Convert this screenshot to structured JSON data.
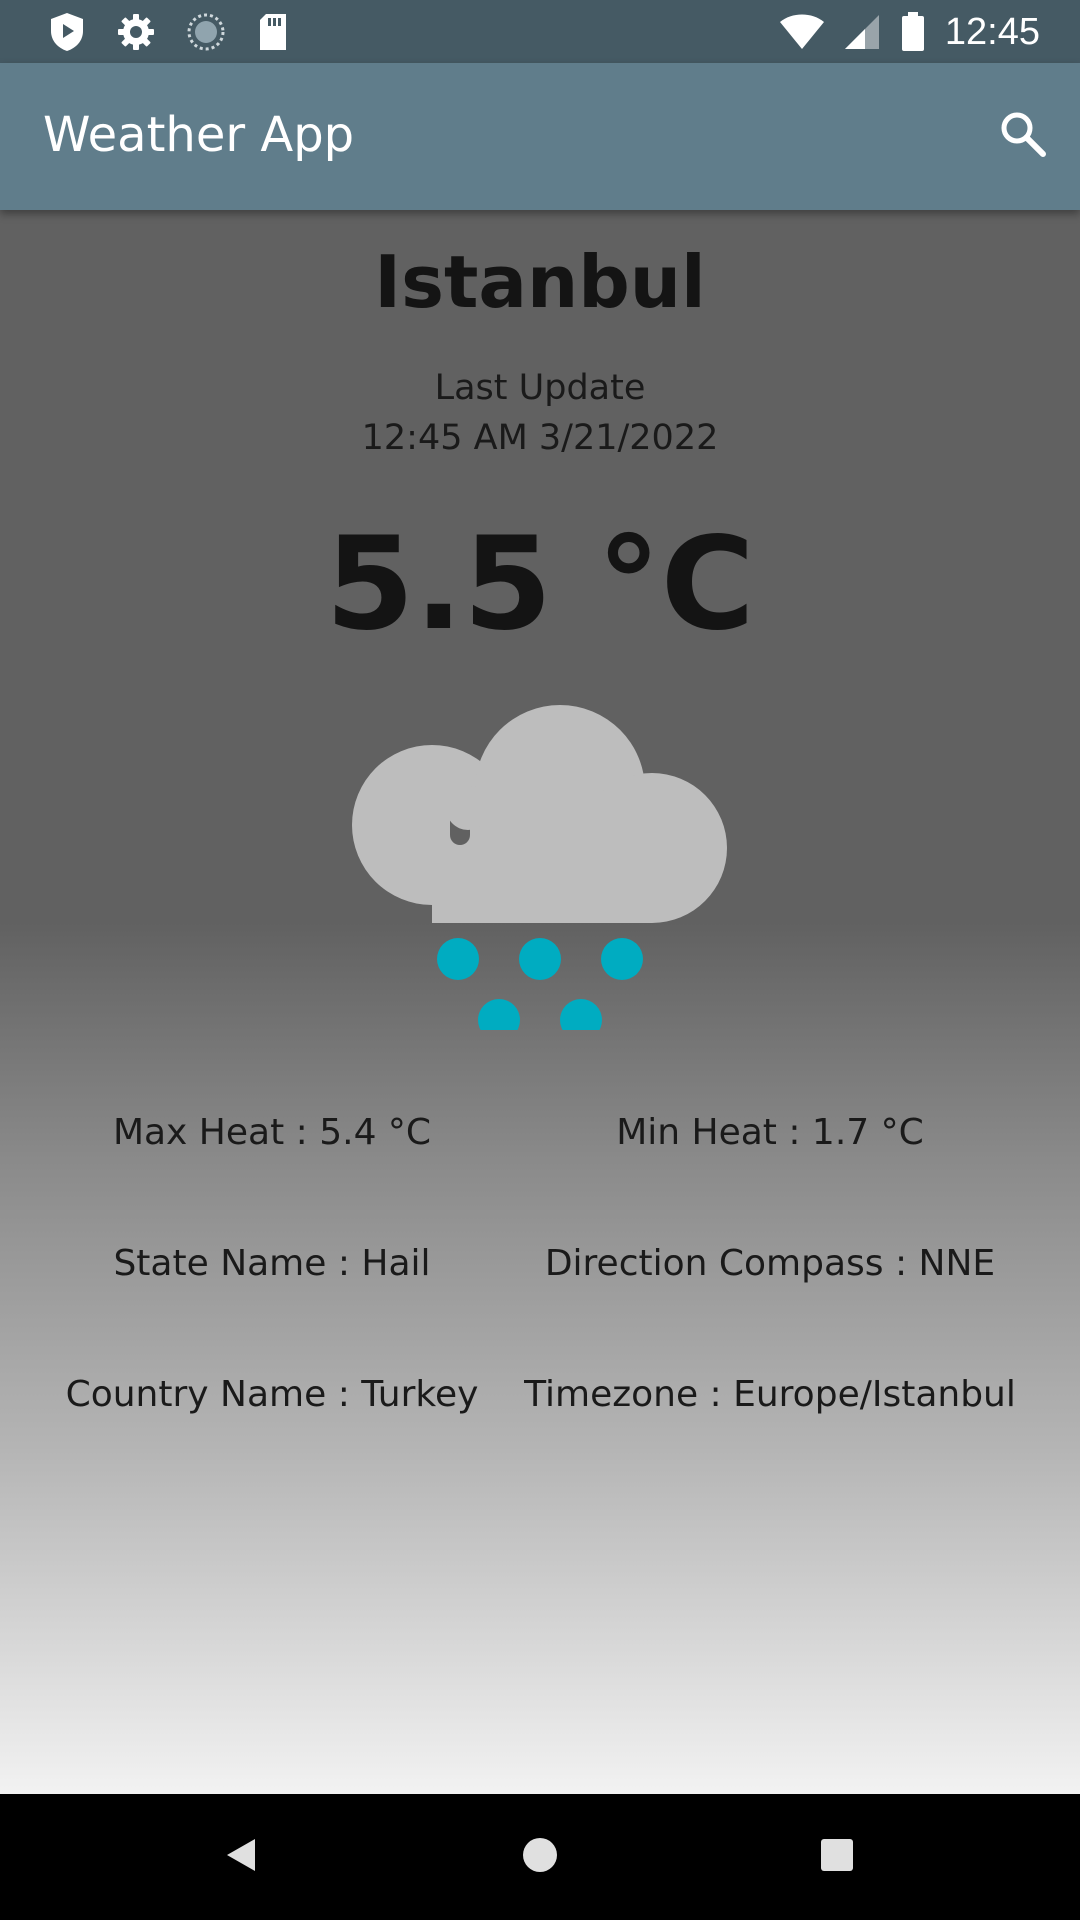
{
  "status_bar": {
    "time": "12:45",
    "left_icons": [
      "shield-icon",
      "gear-icon",
      "sync-icon",
      "sd-card-icon"
    ],
    "right_icons": [
      "wifi-icon",
      "signal-icon",
      "battery-icon"
    ]
  },
  "app_bar": {
    "title": "Weather App",
    "search_icon": "search-icon"
  },
  "weather": {
    "city": "Istanbul",
    "last_update_label": "Last Update",
    "last_update_value": "12:45 AM 3/21/2022",
    "temperature": "5.5 °C",
    "condition_icon": "hail-icon",
    "details": {
      "max_heat": "Max Heat : 5.4 °C",
      "min_heat": "Min Heat : 1.7 °C",
      "state_name": "State Name : Hail",
      "direction_compass": "Direction Compass : NNE",
      "country_name": "Country Name : Turkey",
      "timezone": "Timezone : Europe/Istanbul"
    }
  },
  "colors": {
    "status_bar": "#455a64",
    "app_bar": "#607d8b",
    "cloud": "#bdbdbd",
    "hail": "#00acc1"
  },
  "nav_bar": {
    "buttons": [
      "back-icon",
      "home-icon",
      "recents-icon"
    ]
  }
}
